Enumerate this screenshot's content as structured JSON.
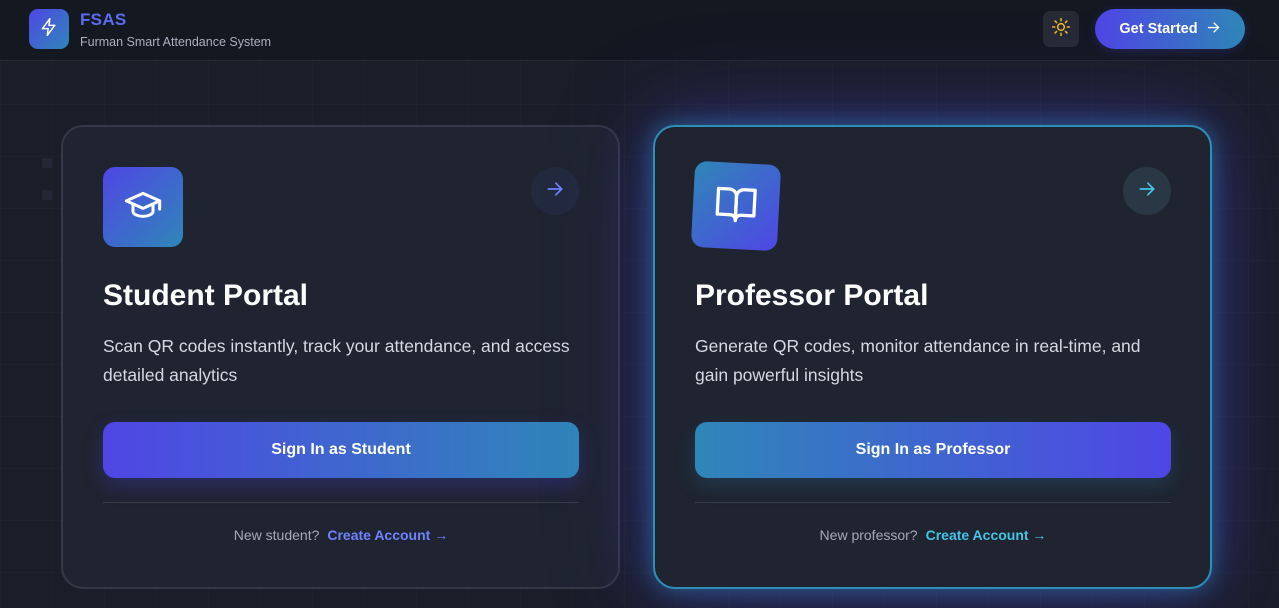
{
  "header": {
    "brand_title": "FSAS",
    "brand_subtitle": "Furman Smart Attendance System",
    "get_started_label": "Get Started"
  },
  "student_card": {
    "title": "Student Portal",
    "description": "Scan QR codes instantly, track your attendance, and access detailed analytics",
    "sign_in_label": "Sign In as Student",
    "footer_prompt": "New student?",
    "create_account_label": "Create Account →"
  },
  "professor_card": {
    "title": "Professor Portal",
    "description": "Generate QR codes, monitor attendance in real-time, and gain powerful insights",
    "sign_in_label": "Sign In as Professor",
    "footer_prompt": "New professor?",
    "create_account_label": "Create Account →"
  },
  "icons": {
    "logo": "lightning-bolt-icon",
    "theme_toggle": "sun-icon",
    "student_tile": "graduation-cap-icon",
    "professor_tile": "open-book-icon",
    "card_arrow": "arrow-right-icon"
  },
  "colors": {
    "primary": "#4f46e5",
    "secondary": "#2f86b8",
    "student_link": "#6f83ff",
    "professor_link": "#44c4e6",
    "sun": "#f5b82e"
  }
}
